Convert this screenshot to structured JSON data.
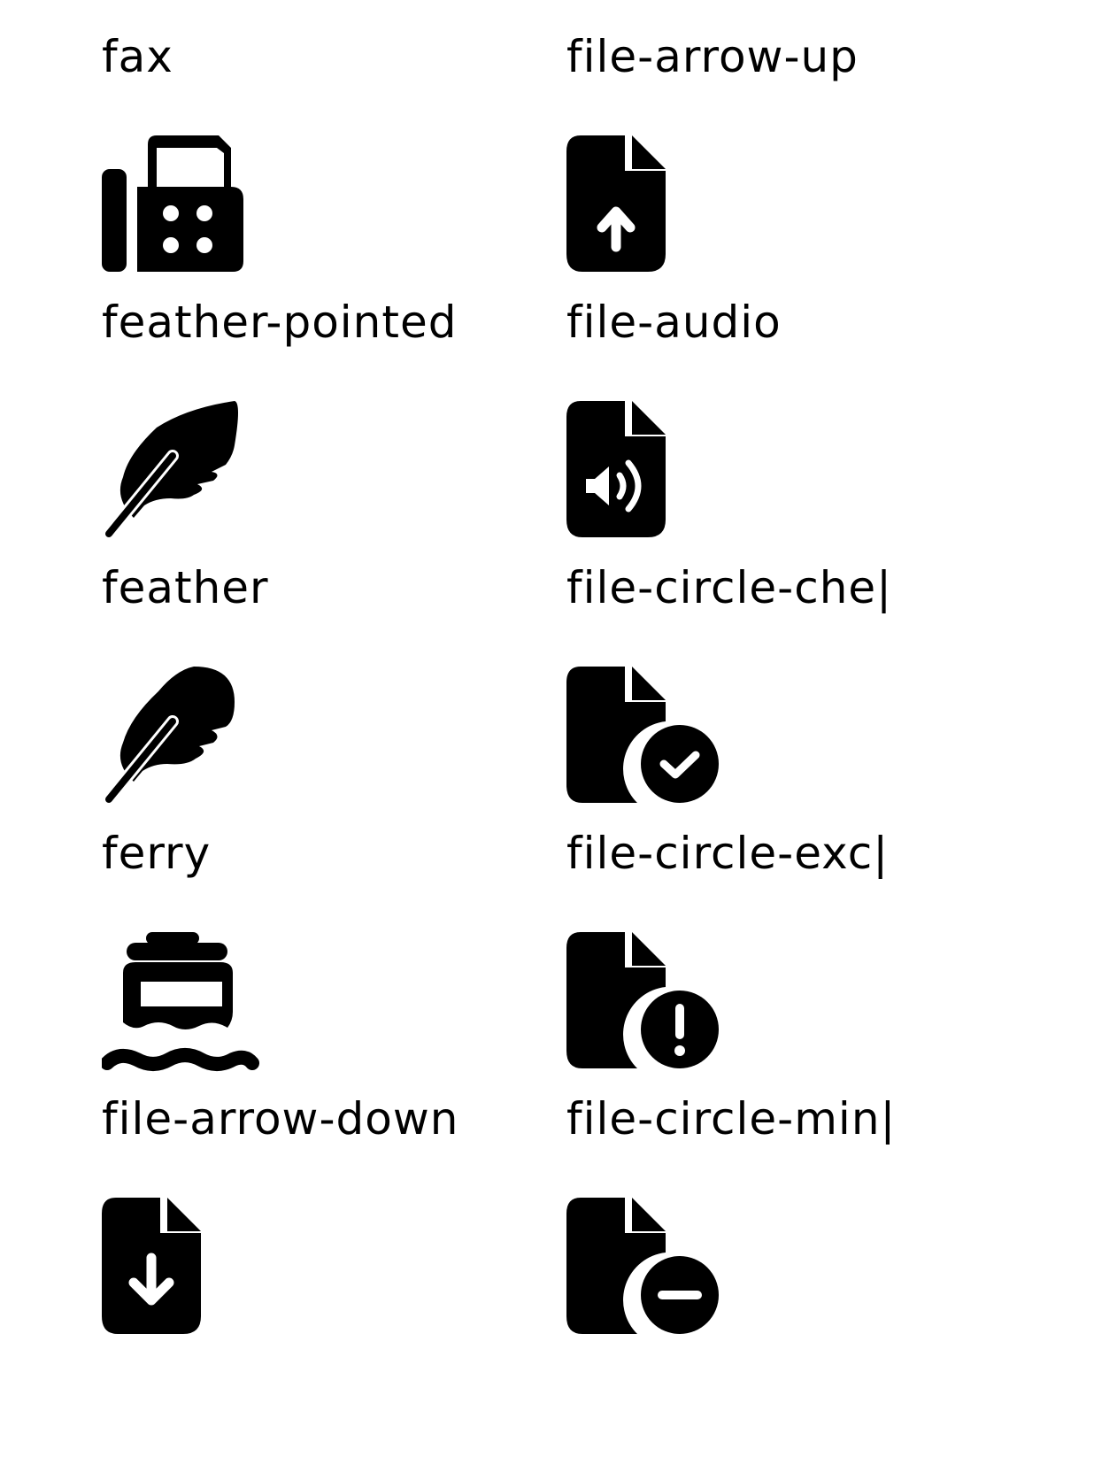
{
  "icons": [
    {
      "label": "fax",
      "icon": "fax-icon"
    },
    {
      "label": "file-arrow-up",
      "icon": "file-arrow-up-icon"
    },
    {
      "label": "feather-pointed",
      "icon": "feather-pointed-icon"
    },
    {
      "label": "file-audio",
      "icon": "file-audio-icon"
    },
    {
      "label": "feather",
      "icon": "feather-icon"
    },
    {
      "label": "file-circle-che|",
      "icon": "file-circle-check-icon"
    },
    {
      "label": "ferry",
      "icon": "ferry-icon"
    },
    {
      "label": "file-circle-exc|",
      "icon": "file-circle-exclamation-icon"
    },
    {
      "label": "file-arrow-down",
      "icon": "file-arrow-down-icon"
    },
    {
      "label": "file-circle-min|",
      "icon": "file-circle-minus-icon"
    }
  ],
  "colors": {
    "foreground": "#000000",
    "background": "#ffffff"
  }
}
